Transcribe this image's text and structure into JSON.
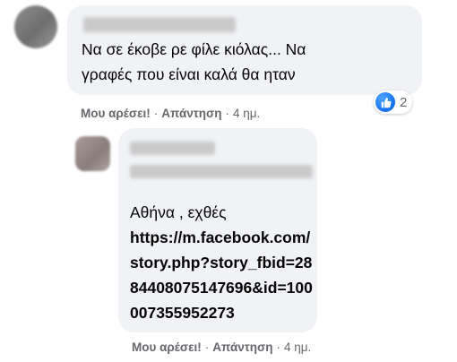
{
  "comments": [
    {
      "text": "Να σε έκοβε ρε φίλε κιόλας... Να\nγραφές που είναι καλά θα ηταν",
      "reaction_count": "2",
      "actions": {
        "like_label": "Μου αρέσει!",
        "reply_label": "Απάντηση",
        "time": "4 ημ."
      }
    },
    {
      "text": "Αθήνα , εχθές",
      "link": "https://m.facebook.com/story.php?story_fbid=2884408075147696&id=100007355952273",
      "actions": {
        "like_label": "Μου αρέσει!",
        "reply_label": "Απάντηση",
        "time": "4 ημ."
      }
    }
  ],
  "separator": "·",
  "icons": {
    "reaction": "like-icon",
    "accent_color": "#1877f2"
  }
}
